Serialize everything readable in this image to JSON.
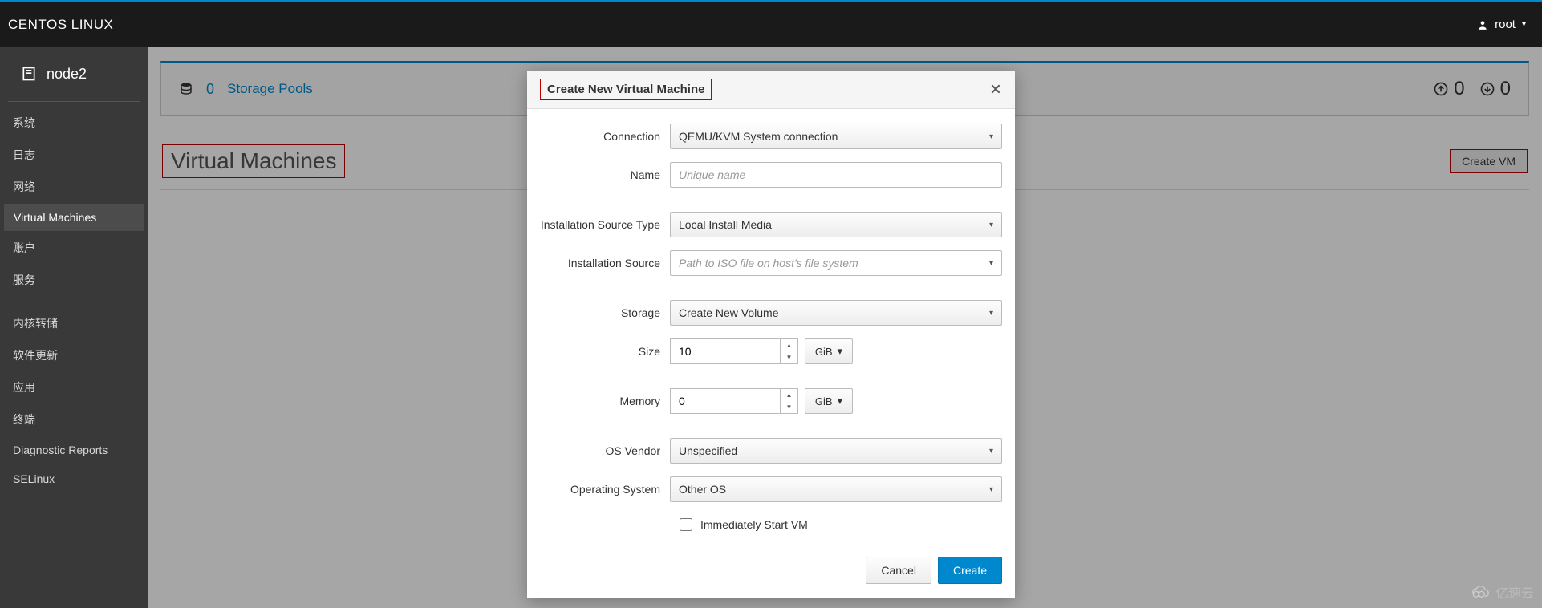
{
  "header": {
    "brand": "CENTOS LINUX",
    "user": "root"
  },
  "host": {
    "name": "node2"
  },
  "sidebar": {
    "items": [
      {
        "label": "系统"
      },
      {
        "label": "日志"
      },
      {
        "label": "网络"
      },
      {
        "label": "Virtual Machines",
        "active": true
      },
      {
        "label": "账户"
      },
      {
        "label": "服务"
      }
    ],
    "items2": [
      {
        "label": "内核转储"
      },
      {
        "label": "软件更新"
      },
      {
        "label": "应用"
      },
      {
        "label": "终端"
      },
      {
        "label": "Diagnostic Reports"
      },
      {
        "label": "SELinux"
      }
    ]
  },
  "pools": {
    "count": "0",
    "label": "Storage Pools",
    "stat_in": "0",
    "stat_out": "0"
  },
  "page": {
    "title": "Virtual Machines",
    "create_btn": "Create VM"
  },
  "modal": {
    "title": "Create New Virtual Machine",
    "labels": {
      "connection": "Connection",
      "name": "Name",
      "install_type": "Installation Source Type",
      "install_source": "Installation Source",
      "storage": "Storage",
      "size": "Size",
      "memory": "Memory",
      "os_vendor": "OS Vendor",
      "os": "Operating System",
      "immediately": "Immediately Start VM"
    },
    "values": {
      "connection": "QEMU/KVM System connection",
      "name_placeholder": "Unique name",
      "install_type": "Local Install Media",
      "install_source_placeholder": "Path to ISO file on host's file system",
      "storage": "Create New Volume",
      "size": "10",
      "size_unit": "GiB",
      "memory": "0",
      "memory_unit": "GiB",
      "os_vendor": "Unspecified",
      "os": "Other OS"
    },
    "buttons": {
      "cancel": "Cancel",
      "create": "Create"
    }
  },
  "watermark": "亿速云"
}
